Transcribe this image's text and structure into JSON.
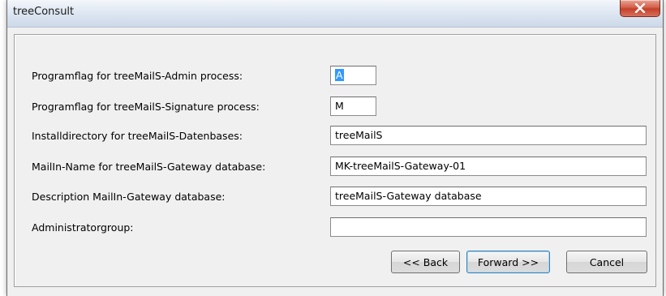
{
  "window": {
    "title": "treeConsult",
    "close_icon": "close-icon"
  },
  "form": {
    "rows": [
      {
        "label": "Programflag for treeMailS-Admin process:",
        "value": "A",
        "selected": true
      },
      {
        "label": "Programflag for treeMailS-Signature process:",
        "value": "M"
      },
      {
        "label": "Installdirectory for treeMailS-Datenbases:",
        "value": "treeMailS"
      },
      {
        "label": "MailIn-Name for treeMailS-Gateway database:",
        "value": "MK-treeMailS-Gateway-01"
      },
      {
        "label": "Description MailIn-Gateway database:",
        "value": "treeMailS-Gateway database"
      },
      {
        "label": "Administratorgroup:",
        "value": ""
      }
    ]
  },
  "buttons": {
    "back": "<< Back",
    "forward": "Forward >>",
    "cancel": "Cancel"
  },
  "colors": {
    "selection": "#3399ff",
    "close_button": "#c3402a",
    "window_bg": "#f0f0f0"
  }
}
